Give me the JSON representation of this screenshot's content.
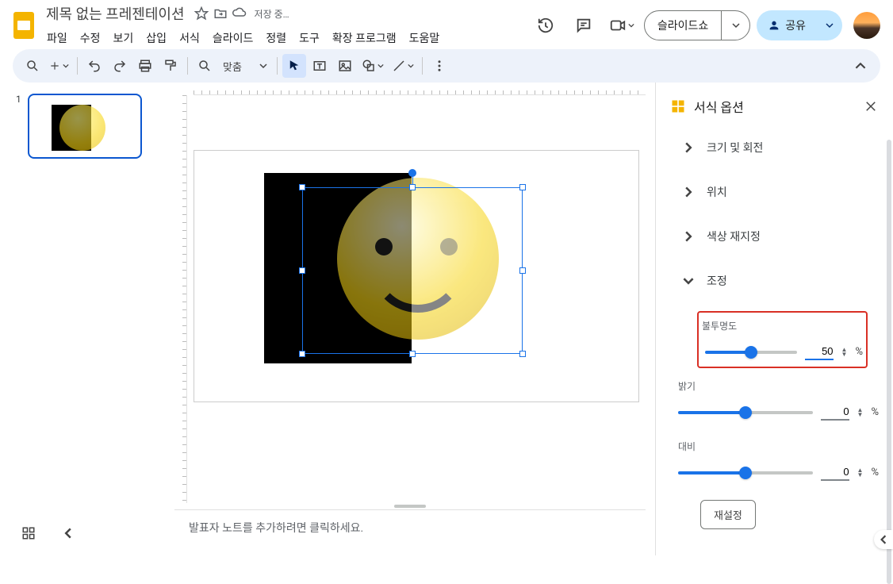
{
  "header": {
    "title": "제목 없는 프레젠테이션",
    "saving": "저장 중…",
    "menus": [
      "파일",
      "수정",
      "보기",
      "삽입",
      "서식",
      "슬라이드",
      "정렬",
      "도구",
      "확장 프로그램",
      "도움말"
    ],
    "slideshow": "슬라이드쇼",
    "share": "공유"
  },
  "toolbar": {
    "fit": "맞춤"
  },
  "thumbs": {
    "slide1_num": "1"
  },
  "notes": {
    "placeholder": "발표자 노트를 추가하려면 클릭하세요."
  },
  "panel": {
    "title": "서식 옵션",
    "sections": {
      "size_rotate": "크기 및 회전",
      "position": "위치",
      "recolor": "색상 재지정",
      "adjust": "조정"
    },
    "adjust": {
      "opacity_label": "불투명도",
      "opacity_value": "50",
      "brightness_label": "밝기",
      "brightness_value": "0",
      "contrast_label": "대비",
      "contrast_value": "0",
      "percent": "%",
      "reset": "재설정"
    }
  }
}
